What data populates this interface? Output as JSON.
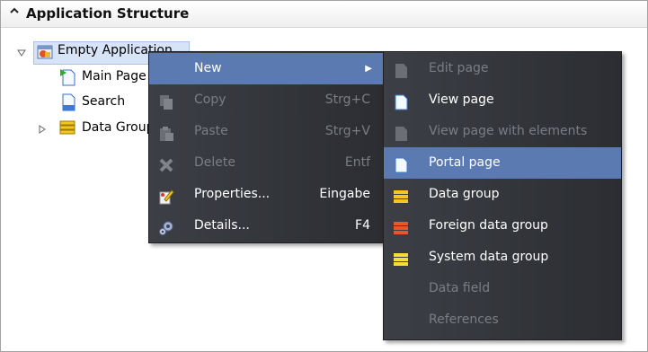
{
  "panel": {
    "title": "Application Structure",
    "collapse_glyph": "^"
  },
  "tree": {
    "root": {
      "label": "Empty Application",
      "expanded": true,
      "icon": "application-icon"
    },
    "children": [
      {
        "label": "Main Page",
        "icon": "start-page-icon"
      },
      {
        "label": "Search",
        "icon": "page-icon"
      },
      {
        "label": "Data Group",
        "icon": "data-group-icon",
        "collapsed": true
      }
    ]
  },
  "context_menu": {
    "items": [
      {
        "label": "New",
        "shortcut": "",
        "state": "highlighted",
        "has_submenu": true,
        "icon": ""
      },
      {
        "label": "Copy",
        "shortcut": "Strg+C",
        "state": "disabled",
        "icon": "copy-icon"
      },
      {
        "label": "Paste",
        "shortcut": "Strg+V",
        "state": "disabled",
        "icon": "paste-icon"
      },
      {
        "label": "Delete",
        "shortcut": "Entf",
        "state": "disabled",
        "icon": "delete-icon"
      },
      {
        "label": "Properties...",
        "shortcut": "Eingabe",
        "state": "enabled",
        "icon": "properties-icon"
      },
      {
        "label": "Details...",
        "shortcut": "F4",
        "state": "enabled",
        "icon": "details-icon"
      }
    ]
  },
  "submenu": {
    "items": [
      {
        "label": "Edit page",
        "state": "disabled",
        "icon": "edit-page-icon"
      },
      {
        "label": "View page",
        "state": "enabled",
        "icon": "view-page-icon"
      },
      {
        "label": "View page with elements",
        "state": "disabled",
        "icon": "view-page-elements-icon"
      },
      {
        "label": "Portal page",
        "state": "highlighted",
        "icon": "portal-page-icon"
      },
      {
        "label": "Data group",
        "state": "enabled",
        "icon": "data-group-icon"
      },
      {
        "label": "Foreign data group",
        "state": "enabled",
        "icon": "foreign-data-group-icon"
      },
      {
        "label": "System data group",
        "state": "enabled",
        "icon": "system-data-group-icon"
      },
      {
        "label": "Data field",
        "state": "disabled",
        "icon": ""
      },
      {
        "label": "References",
        "state": "disabled",
        "icon": ""
      }
    ]
  },
  "colors": {
    "menu_bg": "#2f3237",
    "highlight": "#5b7ab1",
    "disabled_text": "#7a7d83",
    "selection": "#d7e4f7"
  }
}
